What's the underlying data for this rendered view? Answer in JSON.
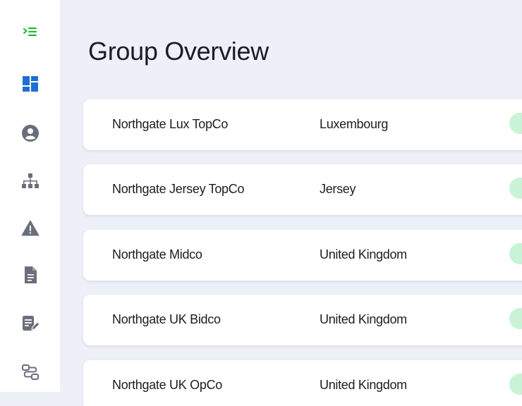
{
  "colors": {
    "accent": "#14b82e",
    "brand_blue": "#1f6fd0",
    "icon_gray": "#6a6e7c",
    "status_green": "#c9f3d6"
  },
  "sidebar": {
    "items": [
      {
        "icon": "menu-collapse-icon"
      },
      {
        "icon": "dashboard-icon",
        "active": true
      },
      {
        "icon": "user-profile-icon"
      },
      {
        "icon": "org-structure-icon"
      },
      {
        "icon": "warning-icon"
      },
      {
        "icon": "document-icon"
      },
      {
        "icon": "edit-document-icon"
      },
      {
        "icon": "workflow-icon"
      }
    ]
  },
  "header": {
    "title": "Group Overview"
  },
  "entities": [
    {
      "name": "Northgate Lux TopCo",
      "country": "Luxembourg"
    },
    {
      "name": "Northgate Jersey TopCo",
      "country": "Jersey"
    },
    {
      "name": "Northgate Midco",
      "country": "United Kingdom"
    },
    {
      "name": "Northgate UK Bidco",
      "country": "United Kingdom"
    },
    {
      "name": "Northgate UK OpCo",
      "country": "United Kingdom"
    }
  ]
}
